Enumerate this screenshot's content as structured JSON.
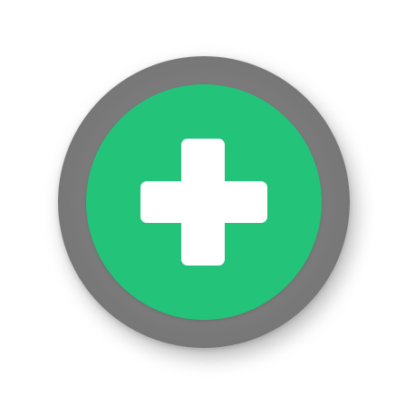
{
  "button": {
    "icon": "plus-icon",
    "face_color": "#23c37a",
    "ring_color": "#7a7a7a",
    "icon_color": "#ffffff"
  }
}
